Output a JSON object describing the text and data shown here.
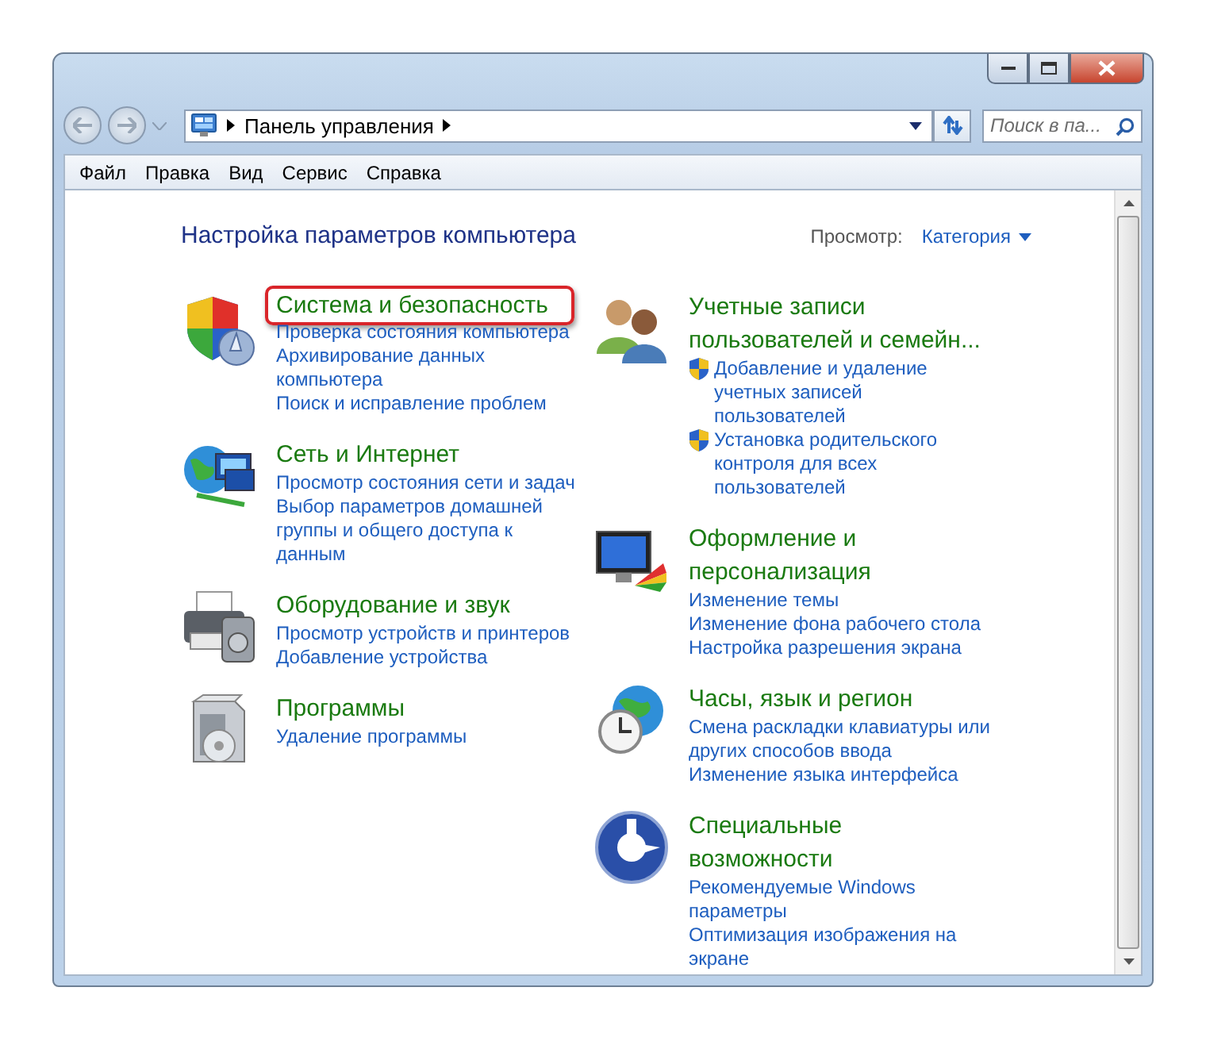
{
  "address_bar": {
    "path": [
      "Панель управления"
    ]
  },
  "search": {
    "placeholder": "Поиск в па..."
  },
  "menu": [
    "Файл",
    "Правка",
    "Вид",
    "Сервис",
    "Справка"
  ],
  "heading": "Настройка параметров компьютера",
  "view": {
    "label": "Просмотр:",
    "value": "Категория"
  },
  "columns": [
    {
      "categories": [
        {
          "kind": "security",
          "title": "Система и безопасность",
          "highlighted": true,
          "links": [
            {
              "text": "Проверка состояния компьютера",
              "shield": false
            },
            {
              "text": "Архивирование данных компьютера",
              "shield": false
            },
            {
              "text": "Поиск и исправление проблем",
              "shield": false
            }
          ]
        },
        {
          "kind": "network",
          "title": "Сеть и Интернет",
          "highlighted": false,
          "links": [
            {
              "text": "Просмотр состояния сети и задач",
              "shield": false
            },
            {
              "text": "Выбор параметров домашней группы и общего доступа к данным",
              "shield": false
            }
          ]
        },
        {
          "kind": "hardware",
          "title": "Оборудование и звук",
          "highlighted": false,
          "links": [
            {
              "text": "Просмотр устройств и принтеров",
              "shield": false
            },
            {
              "text": "Добавление устройства",
              "shield": false
            }
          ]
        },
        {
          "kind": "programs",
          "title": "Программы",
          "highlighted": false,
          "links": [
            {
              "text": "Удаление программы",
              "shield": false
            }
          ]
        }
      ]
    },
    {
      "categories": [
        {
          "kind": "users",
          "title": "Учетные записи пользователей и семейн...",
          "highlighted": false,
          "links": [
            {
              "text": "Добавление и удаление учетных записей пользователей",
              "shield": true
            },
            {
              "text": "Установка родительского контроля для всех пользователей",
              "shield": true
            }
          ]
        },
        {
          "kind": "appearance",
          "title": "Оформление и персонализация",
          "highlighted": false,
          "links": [
            {
              "text": "Изменение темы",
              "shield": false
            },
            {
              "text": "Изменение фона рабочего стола",
              "shield": false
            },
            {
              "text": "Настройка разрешения экрана",
              "shield": false
            }
          ]
        },
        {
          "kind": "clock",
          "title": "Часы, язык и регион",
          "highlighted": false,
          "links": [
            {
              "text": "Смена раскладки клавиатуры или других способов ввода",
              "shield": false
            },
            {
              "text": "Изменение языка интерфейса",
              "shield": false
            }
          ]
        },
        {
          "kind": "access",
          "title": "Специальные возможности",
          "highlighted": false,
          "links": [
            {
              "text": "Рекомендуемые Windows параметры",
              "shield": false
            },
            {
              "text": "Оптимизация изображения на экране",
              "shield": false
            }
          ]
        }
      ]
    }
  ]
}
